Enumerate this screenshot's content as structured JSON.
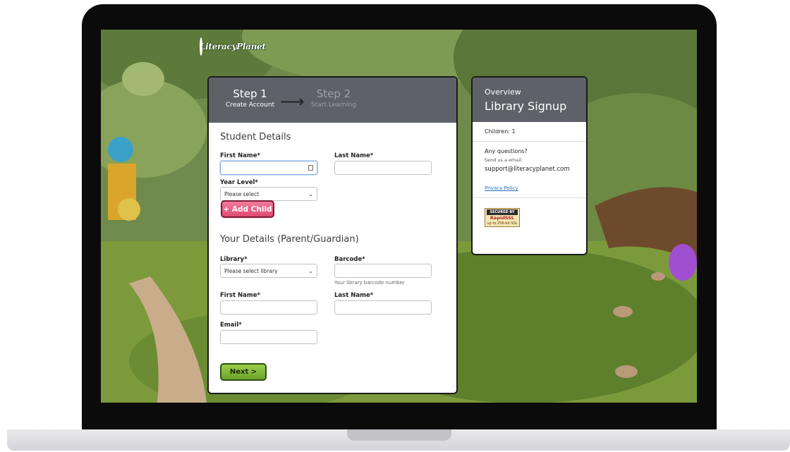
{
  "logo": {
    "text": "LiteracyPlanet"
  },
  "steps": [
    {
      "number": "Step 1",
      "label": "Create Account"
    },
    {
      "number": "Step 2",
      "label": "Start Learning"
    }
  ],
  "student": {
    "title": "Student Details",
    "first_name_label": "First Name*",
    "last_name_label": "Last Name*",
    "year_level_label": "Year Level*",
    "year_level_value": "Please select",
    "add_child_label": "+ Add Child"
  },
  "parent": {
    "title": "Your Details (Parent/Guardian)",
    "library_label": "Library*",
    "library_value": "Please select library",
    "barcode_label": "Barcode*",
    "barcode_hint": "Your library barcode number",
    "first_name_label": "First Name*",
    "last_name_label": "Last Name*",
    "email_label": "Email*"
  },
  "next_label": "Next >",
  "sidebar": {
    "overview": "Overview",
    "title": "Library Signup",
    "children": "Children: 1",
    "questions": "Any questions?",
    "send_email": "Send us a email:",
    "email": "support@literacyplanet.com",
    "privacy": "Privacy Policy",
    "ssl_top": "SECURED BY",
    "ssl_mid": "RapidSSL",
    "ssl_bottom": "up to 256-bit SSL"
  },
  "icons": {
    "dropdown": "chevron-down-icon",
    "autofill": "contact-card-icon",
    "step_arrow": "arrow-right-icon"
  },
  "colors": {
    "header": "#5e6268",
    "add_child": "#e04a72",
    "next": "#6aa32a",
    "link": "#2a6fc0"
  }
}
